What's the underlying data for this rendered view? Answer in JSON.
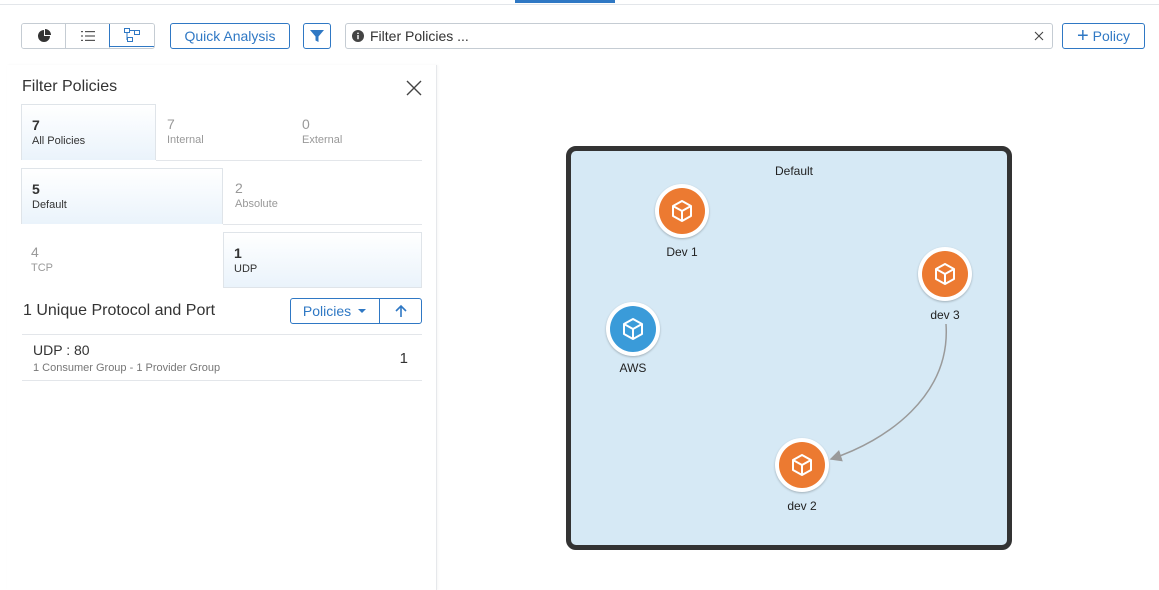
{
  "colors": {
    "accent": "#2f78c4",
    "node_orange": "#ec7a31",
    "node_blue": "#3a9bd9",
    "graph_bg": "#d6e9f5",
    "edge": "#9a9a9a"
  },
  "toolbar": {
    "view_buttons": [
      "pie-chart-icon",
      "list-icon",
      "topology-icon"
    ],
    "quick_analysis_label": "Quick Analysis",
    "search_placeholder": "Filter Policies ...",
    "add_policy_label": "Policy"
  },
  "filter_panel": {
    "title": "Filter Policies",
    "scope_tiles": [
      {
        "count": "7",
        "label": "All Policies"
      },
      {
        "count": "7",
        "label": "Internal"
      },
      {
        "count": "0",
        "label": "External"
      }
    ],
    "type_tiles": [
      {
        "count": "5",
        "label": "Default"
      },
      {
        "count": "2",
        "label": "Absolute"
      }
    ],
    "protocol_tiles": [
      {
        "count": "4",
        "label": "TCP"
      },
      {
        "count": "1",
        "label": "UDP"
      }
    ],
    "unique_title": "1 Unique Protocol and Port",
    "policies_dropdown": "Policies",
    "protocols": [
      {
        "name": "UDP : 80",
        "detail": "1 Consumer Group - 1 Provider Group",
        "count": "1"
      }
    ]
  },
  "graph": {
    "title": "Default",
    "nodes": [
      {
        "name": "Dev 1",
        "color": "orange"
      },
      {
        "name": "dev 3",
        "color": "orange"
      },
      {
        "name": "AWS",
        "color": "blue"
      },
      {
        "name": "dev 2",
        "color": "orange"
      }
    ],
    "edges": [
      {
        "from": "dev 3",
        "to": "dev 2"
      }
    ]
  }
}
